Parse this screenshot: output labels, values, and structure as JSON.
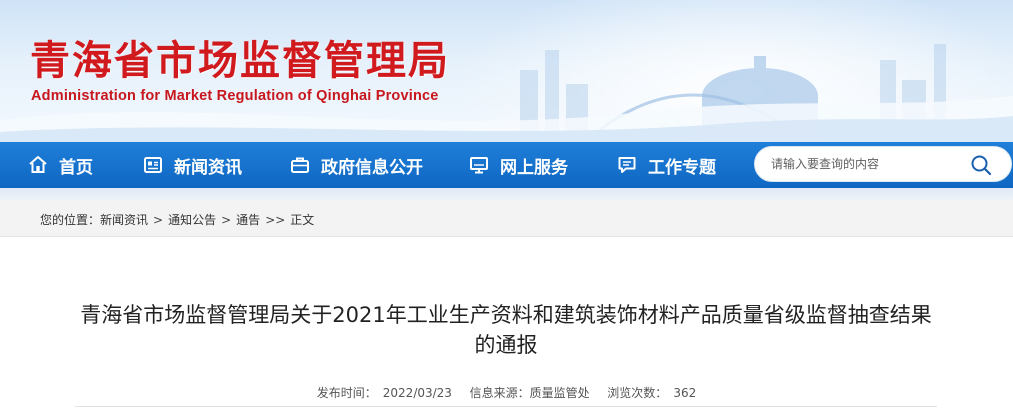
{
  "header": {
    "title": "青海省市场监督管理局",
    "subtitle": "Administration for Market Regulation of Qinghai Province"
  },
  "nav": {
    "items": [
      {
        "label": "首页",
        "icon": "home-icon"
      },
      {
        "label": "新闻资讯",
        "icon": "news-icon"
      },
      {
        "label": "政府信息公开",
        "icon": "briefcase-icon"
      },
      {
        "label": "网上服务",
        "icon": "monitor-icon"
      },
      {
        "label": "工作专题",
        "icon": "chat-icon"
      }
    ],
    "search_placeholder": "请输入要查询的内容"
  },
  "breadcrumb": {
    "prefix": "您的位置：",
    "items": [
      "新闻资讯",
      "通知公告",
      "通告",
      "正文"
    ],
    "separators": [
      ">",
      ">",
      ">>"
    ]
  },
  "article": {
    "title": "青海省市场监督管理局关于2021年工业生产资料和建筑装饰材料产品质量省级监督抽查结果的通报",
    "meta": {
      "date_label": "发布时间：",
      "date": "2022/03/23",
      "source_label": "信息来源：",
      "source": "质量监管处",
      "views_label": "浏览次数：",
      "views": "362"
    }
  },
  "colors": {
    "title_red": "#d11a1e",
    "nav_blue": "#1474d0",
    "breadcrumb_bg": "#f3f3f3"
  }
}
